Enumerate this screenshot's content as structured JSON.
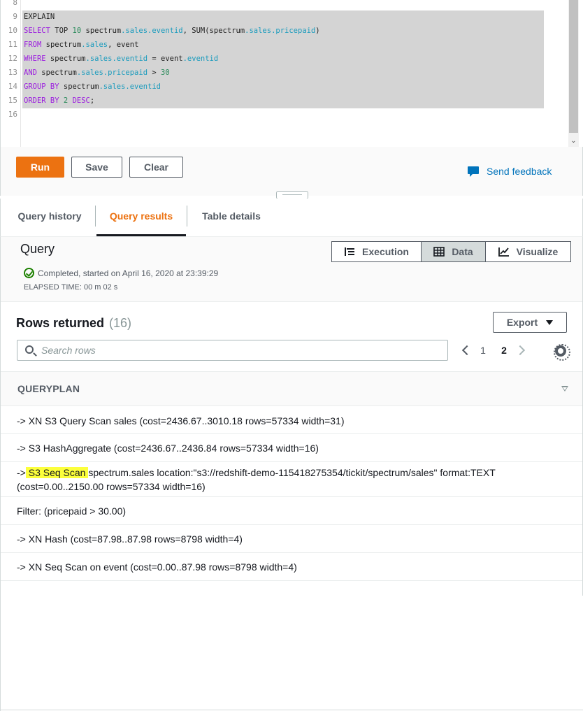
{
  "editor": {
    "line_numbers": [
      "8",
      "9",
      "10",
      "11",
      "12",
      "13",
      "14",
      "15",
      "16"
    ],
    "lines": [
      [
        {
          "t": "EXPLAIN",
          "c": "ident"
        }
      ],
      [
        {
          "t": "SELECT",
          "c": "kw"
        },
        {
          "t": " TOP ",
          "c": "ident"
        },
        {
          "t": "10",
          "c": "num"
        },
        {
          "t": " spectrum",
          "c": "ident"
        },
        {
          "t": ".sales.eventid",
          "c": "field"
        },
        {
          "t": ", SUM(spectrum",
          "c": "ident"
        },
        {
          "t": ".sales.pricepaid",
          "c": "field"
        },
        {
          "t": ")",
          "c": "ident"
        }
      ],
      [
        {
          "t": "FROM",
          "c": "kw"
        },
        {
          "t": " spectrum",
          "c": "ident"
        },
        {
          "t": ".sales",
          "c": "field"
        },
        {
          "t": ", event",
          "c": "ident"
        }
      ],
      [
        {
          "t": "WHERE",
          "c": "kw"
        },
        {
          "t": " spectrum",
          "c": "ident"
        },
        {
          "t": ".sales.eventid",
          "c": "field"
        },
        {
          "t": " = event",
          "c": "ident"
        },
        {
          "t": ".eventid",
          "c": "field"
        }
      ],
      [
        {
          "t": "AND",
          "c": "kw"
        },
        {
          "t": " spectrum",
          "c": "ident"
        },
        {
          "t": ".sales.pricepaid",
          "c": "field"
        },
        {
          "t": " > ",
          "c": "ident"
        },
        {
          "t": "30",
          "c": "num"
        }
      ],
      [
        {
          "t": "GROUP BY",
          "c": "kw"
        },
        {
          "t": " spectrum",
          "c": "ident"
        },
        {
          "t": ".sales.eventid",
          "c": "field"
        }
      ],
      [
        {
          "t": "ORDER BY",
          "c": "kw"
        },
        {
          "t": " ",
          "c": "ident"
        },
        {
          "t": "2",
          "c": "num"
        },
        {
          "t": " ",
          "c": "ident"
        },
        {
          "t": "DESC",
          "c": "kw"
        },
        {
          "t": ";",
          "c": "ident"
        }
      ],
      []
    ]
  },
  "actions": {
    "run_label": "Run",
    "save_label": "Save",
    "clear_label": "Clear",
    "feedback_label": "Send feedback"
  },
  "tabs": {
    "history": "Query history",
    "results": "Query results",
    "details": "Table details",
    "active": "results"
  },
  "query": {
    "title": "Query",
    "status": "Completed, started on April 16, 2020 at 23:39:29",
    "elapsed": "ELAPSED TIME: 00 m 02 s",
    "views": {
      "execution": "Execution",
      "data": "Data",
      "visualize": "Visualize",
      "selected": "data"
    }
  },
  "results": {
    "title": "Rows returned",
    "count": "(16)",
    "export_label": "Export",
    "search_placeholder": "Search rows",
    "search_value": "",
    "pages": [
      "1",
      "2"
    ],
    "current_page": "2",
    "column_header": "QUERYPLAN",
    "rows": [
      {
        "text": "-> XN S3 Query Scan sales (cost=2436.67..3010.18 rows=57334 width=31)"
      },
      {
        "text": "-> S3 HashAggregate (cost=2436.67..2436.84 rows=57334 width=16)"
      },
      {
        "pre": "->",
        "highlight": " S3 Seq Scan ",
        "text": "spectrum.sales location:\"s3://redshift-demo-115418275354/tickit/spectrum/sales\" format:TEXT (cost=0.00..2150.00 rows=57334 width=16)"
      },
      {
        "text": "Filter: (pricepaid > 30.00)"
      },
      {
        "text": "-> XN Hash (cost=87.98..87.98 rows=8798 width=4)"
      },
      {
        "text": "-> XN Seq Scan on event (cost=0.00..87.98 rows=8798 width=4)"
      }
    ]
  },
  "colors": {
    "accent": "#ec7211",
    "link": "#0073bb",
    "success": "#1d8102",
    "highlight": "#fcff3c"
  },
  "icons": [
    "execution-icon",
    "data-grid-icon",
    "visualize-chart-icon",
    "search-icon",
    "chevron-left-icon",
    "chevron-right-icon",
    "gear-icon",
    "caret-down-icon",
    "feedback-icon",
    "check-circle-icon",
    "sort-icon"
  ]
}
